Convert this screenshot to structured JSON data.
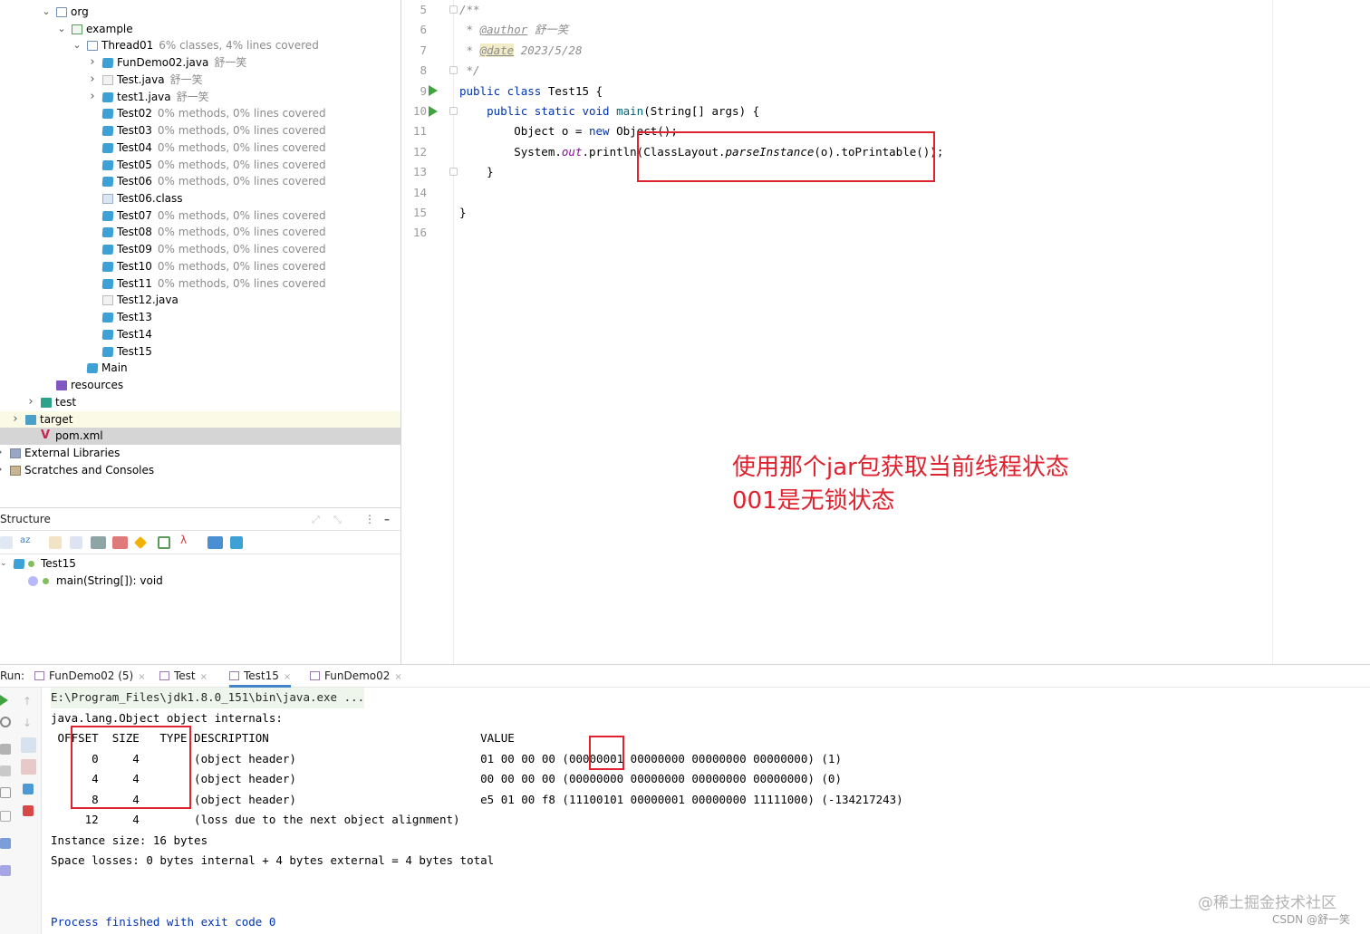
{
  "project_tree": [
    {
      "indent": 2,
      "chev": "v",
      "icon": "folder",
      "label": "org",
      "note": ""
    },
    {
      "indent": 3,
      "chev": "v",
      "icon": "package",
      "label": "example",
      "note": ""
    },
    {
      "indent": 4,
      "chev": "v",
      "icon": "folder",
      "label": "Thread01",
      "note": "6% classes, 4% lines covered"
    },
    {
      "indent": 5,
      "chev": ">",
      "icon": "class",
      "label": "FunDemo02.java",
      "note": "舒一笑"
    },
    {
      "indent": 5,
      "chev": ">",
      "icon": "javafile",
      "label": "Test.java",
      "note": "舒一笑"
    },
    {
      "indent": 5,
      "chev": ">",
      "icon": "class",
      "label": "test1.java",
      "note": "舒一笑"
    },
    {
      "indent": 5,
      "chev": "",
      "icon": "class",
      "label": "Test02",
      "note": "0% methods, 0% lines covered"
    },
    {
      "indent": 5,
      "chev": "",
      "icon": "class",
      "label": "Test03",
      "note": "0% methods, 0% lines covered"
    },
    {
      "indent": 5,
      "chev": "",
      "icon": "class",
      "label": "Test04",
      "note": "0% methods, 0% lines covered"
    },
    {
      "indent": 5,
      "chev": "",
      "icon": "class",
      "label": "Test05",
      "note": "0% methods, 0% lines covered"
    },
    {
      "indent": 5,
      "chev": "",
      "icon": "class",
      "label": "Test06",
      "note": "0% methods, 0% lines covered"
    },
    {
      "indent": 5,
      "chev": "",
      "icon": "classfile",
      "label": "Test06.class",
      "note": ""
    },
    {
      "indent": 5,
      "chev": "",
      "icon": "class",
      "label": "Test07",
      "note": "0% methods, 0% lines covered"
    },
    {
      "indent": 5,
      "chev": "",
      "icon": "class",
      "label": "Test08",
      "note": "0% methods, 0% lines covered"
    },
    {
      "indent": 5,
      "chev": "",
      "icon": "class",
      "label": "Test09",
      "note": "0% methods, 0% lines covered"
    },
    {
      "indent": 5,
      "chev": "",
      "icon": "class",
      "label": "Test10",
      "note": "0% methods, 0% lines covered"
    },
    {
      "indent": 5,
      "chev": "",
      "icon": "class",
      "label": "Test11",
      "note": "0% methods, 0% lines covered"
    },
    {
      "indent": 5,
      "chev": "",
      "icon": "javafile",
      "label": "Test12.java",
      "note": ""
    },
    {
      "indent": 5,
      "chev": "",
      "icon": "class",
      "label": "Test13",
      "note": ""
    },
    {
      "indent": 5,
      "chev": "",
      "icon": "class",
      "label": "Test14",
      "note": ""
    },
    {
      "indent": 5,
      "chev": "",
      "icon": "class",
      "label": "Test15",
      "note": ""
    },
    {
      "indent": 4,
      "chev": "",
      "icon": "class",
      "label": "Main",
      "note": ""
    },
    {
      "indent": 2,
      "chev": "",
      "icon": "resources",
      "label": "resources",
      "note": ""
    },
    {
      "indent": 1,
      "chev": ">",
      "icon": "test",
      "label": "test",
      "note": ""
    },
    {
      "indent": 0,
      "chev": ">",
      "icon": "target",
      "label": "target",
      "note": "",
      "hl": true
    },
    {
      "indent": 1,
      "chev": "",
      "icon": "maven",
      "label": "pom.xml",
      "note": "",
      "sel": true
    },
    {
      "indent": -1,
      "chev": ">",
      "icon": "library",
      "label": "External Libraries",
      "note": ""
    },
    {
      "indent": -1,
      "chev": ">",
      "icon": "scratch",
      "label": "Scratches and Consoles",
      "note": ""
    }
  ],
  "structure": {
    "title": "Structure",
    "root": "Test15",
    "child": "main(String[]): void"
  },
  "editor": {
    "line_numbers": [
      "5",
      "6",
      "7",
      "8",
      "9",
      "10",
      "11",
      "12",
      "13",
      "14",
      "15",
      "16"
    ]
  },
  "annotation": {
    "line1": "使用那个jar包获取当前线程状态",
    "line2": "001是无锁状态"
  },
  "run": {
    "label": "Run:",
    "tabs": [
      {
        "label": "FunDemo02 (5)",
        "close": "×"
      },
      {
        "label": "Test",
        "close": "×"
      },
      {
        "label": "Test15",
        "close": "×",
        "active": true
      },
      {
        "label": "FunDemo02",
        "close": "×"
      }
    ],
    "console_lines": [
      "E:\\Program_Files\\jdk1.8.0_151\\bin\\java.exe ...",
      "java.lang.Object object internals:",
      " OFFSET  SIZE   TYPE DESCRIPTION                               VALUE",
      "      0     4        (object header)                           01 00 00 00 (00000001 00000000 00000000 00000000) (1)",
      "      4     4        (object header)                           00 00 00 00 (00000000 00000000 00000000 00000000) (0)",
      "      8     4        (object header)                           e5 01 00 f8 (11100101 00000001 00000000 11111000) (-134217243)",
      "     12     4        (loss due to the next object alignment)",
      "Instance size: 16 bytes",
      "Space losses: 0 bytes internal + 4 bytes external = 4 bytes total",
      "",
      "",
      "Process finished with exit code 0"
    ]
  },
  "watermark": {
    "line1": "@稀土掘金技术社区",
    "line2": "CSDN @舒一笑"
  }
}
